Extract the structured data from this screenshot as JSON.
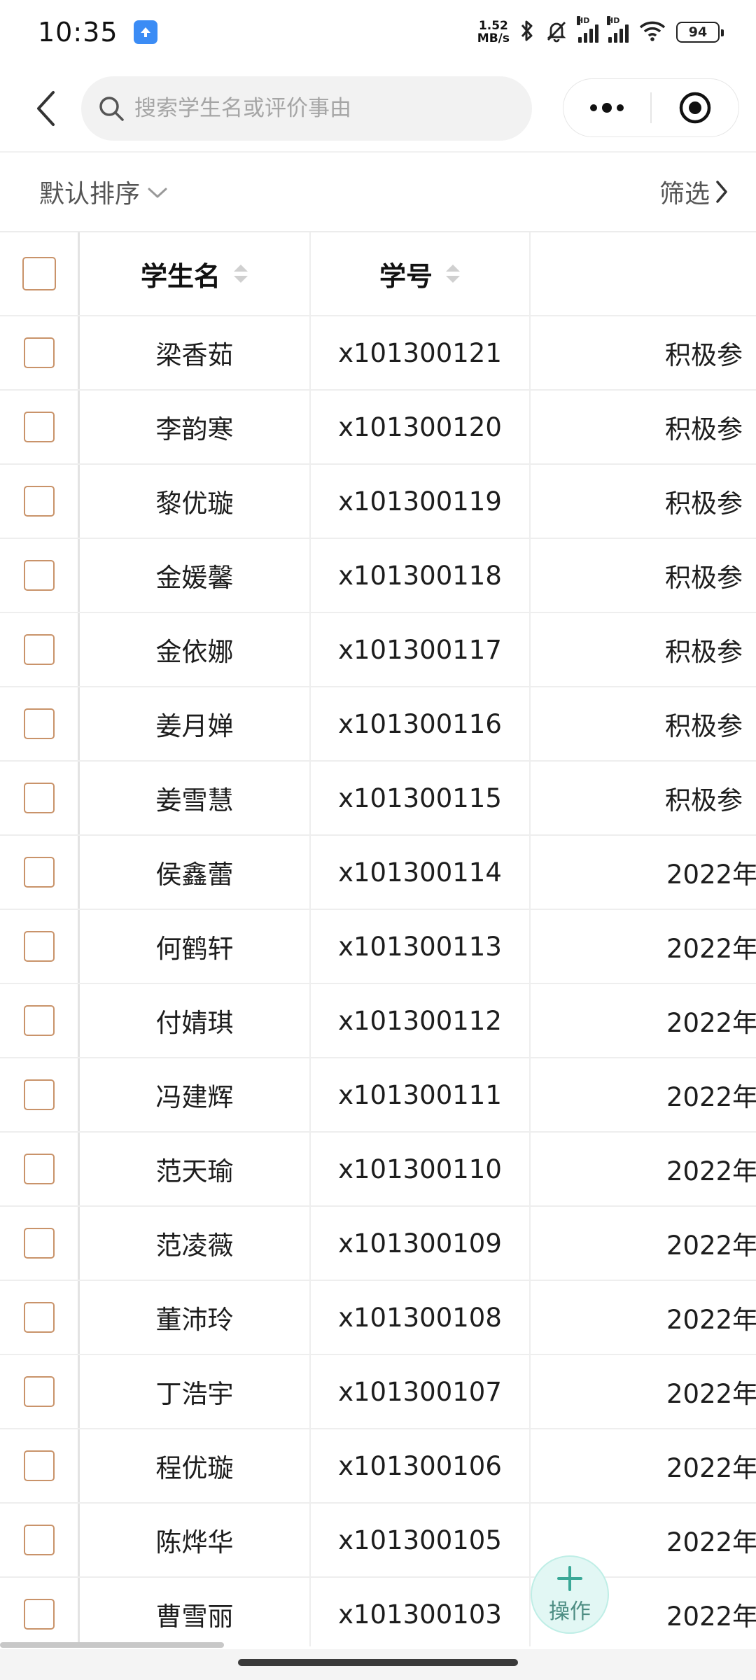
{
  "status_bar": {
    "time": "10:35",
    "net_speed_value": "1.52",
    "net_speed_unit": "MB/s",
    "signal_1_tag": "HD",
    "signal_2_tag": "HD",
    "battery": "94"
  },
  "nav": {
    "search_placeholder": "搜索学生名或评价事由"
  },
  "toolbar": {
    "sort_label": "默认排序",
    "filter_label": "筛选"
  },
  "table": {
    "headers": {
      "name": "学生名",
      "id": "学号"
    },
    "rows": [
      {
        "name": "梁香茹",
        "id": "x101300121",
        "reason": "积极参"
      },
      {
        "name": "李韵寒",
        "id": "x101300120",
        "reason": "积极参"
      },
      {
        "name": "黎优璇",
        "id": "x101300119",
        "reason": "积极参"
      },
      {
        "name": "金媛馨",
        "id": "x101300118",
        "reason": "积极参"
      },
      {
        "name": "金依娜",
        "id": "x101300117",
        "reason": "积极参"
      },
      {
        "name": "姜月婵",
        "id": "x101300116",
        "reason": "积极参"
      },
      {
        "name": "姜雪慧",
        "id": "x101300115",
        "reason": "积极参"
      },
      {
        "name": "侯鑫蕾",
        "id": "x101300114",
        "reason": "2022年"
      },
      {
        "name": "何鹤轩",
        "id": "x101300113",
        "reason": "2022年"
      },
      {
        "name": "付婧琪",
        "id": "x101300112",
        "reason": "2022年"
      },
      {
        "name": "冯建辉",
        "id": "x101300111",
        "reason": "2022年"
      },
      {
        "name": "范天瑜",
        "id": "x101300110",
        "reason": "2022年"
      },
      {
        "name": "范凌薇",
        "id": "x101300109",
        "reason": "2022年"
      },
      {
        "name": "董沛玲",
        "id": "x101300108",
        "reason": "2022年"
      },
      {
        "name": "丁浩宇",
        "id": "x101300107",
        "reason": "2022年"
      },
      {
        "name": "程优璇",
        "id": "x101300106",
        "reason": "2022年"
      },
      {
        "name": "陈烨华",
        "id": "x101300105",
        "reason": "2022年"
      },
      {
        "name": "曹雪丽",
        "id": "x101300103",
        "reason": "2022年"
      }
    ]
  },
  "fab": {
    "label": "操作"
  },
  "colors": {
    "checkbox_border": "#c9936a",
    "fab_background": "#e2f7f4",
    "fab_accent": "#4d8d83"
  }
}
